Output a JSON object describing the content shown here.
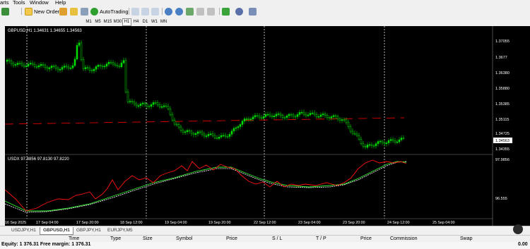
{
  "menu": {
    "items": [
      "arts",
      "Tools",
      "Window",
      "Help"
    ]
  },
  "toolbar": {
    "new_order": "New Order",
    "auto_trading": "AutoTrading"
  },
  "timeframes": [
    "M1",
    "M5",
    "M15",
    "M30",
    "H1",
    "H4",
    "D1",
    "W1",
    "MN"
  ],
  "active_timeframe": "H1",
  "chart": {
    "main_header": "GBPUSD,H1  1.34631  1.34655  1.34563",
    "indicator_header": "USDX  97.8856  97.8130  97.8220",
    "price_ticks": [
      "1.37055",
      "1.3677",
      "1.36380",
      "1.35880",
      "1.35385",
      "1.35115",
      "1.34725",
      "1.34563",
      "1.34355"
    ],
    "current_price": "1.34563",
    "indicator_ticks": [
      "97.9856",
      "96.555"
    ],
    "time_labels": [
      "16 Sep 2025",
      "17 Sep 04:00",
      "17 Sep 20:00",
      "18 Sep 12:00",
      "19 Sep 04:00",
      "19 Sep 20:00",
      "22 Sep 12:00",
      "23 Sep 04:00",
      "23 Sep 20:00",
      "24 Sep 12:00",
      "25 Sep 04:00"
    ],
    "colors": {
      "background": "#000000",
      "candle": "#00dd00",
      "red_line": "#ff0000",
      "green_line": "#33ee33",
      "white_line": "#ffffff"
    }
  },
  "tabs": [
    "USDJPY,H1",
    "GBPUSD,H1",
    "GBPJPY,H1",
    "EURJPY,M5"
  ],
  "active_tab": "GBPUSD,H1",
  "terminal_columns": [
    "Time",
    "Type",
    "Size",
    "Symbol",
    "Price",
    "S / L",
    "T / P",
    "Price",
    "Commission",
    "Swap"
  ],
  "status": {
    "equity_text": "Equity: 1 376.31  Free margin: 1 376.31",
    "right_value": "0.00"
  }
}
